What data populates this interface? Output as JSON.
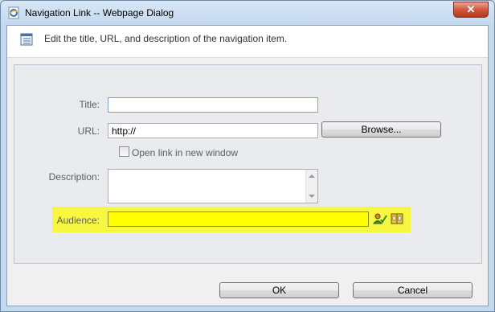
{
  "window": {
    "title": "Navigation Link -- Webpage Dialog",
    "close_glyph": "✕"
  },
  "header": {
    "text": "Edit the title, URL, and description of the navigation item."
  },
  "form": {
    "title_label": "Title:",
    "title_value": "",
    "url_label": "URL:",
    "url_value": "http://",
    "browse_label": "Browse...",
    "open_new_window_label": "Open link in new window",
    "open_new_window_checked": false,
    "description_label": "Description:",
    "description_value": "",
    "audience_label": "Audience:",
    "audience_value": ""
  },
  "footer": {
    "ok_label": "OK",
    "cancel_label": "Cancel"
  },
  "colors": {
    "highlight": "#f7f742",
    "audience_field": "#ffff00"
  },
  "icons": {
    "app": "ie-page-icon",
    "header": "list-icon",
    "check_names": "check-names-icon",
    "browse_audiences": "address-book-icon"
  }
}
